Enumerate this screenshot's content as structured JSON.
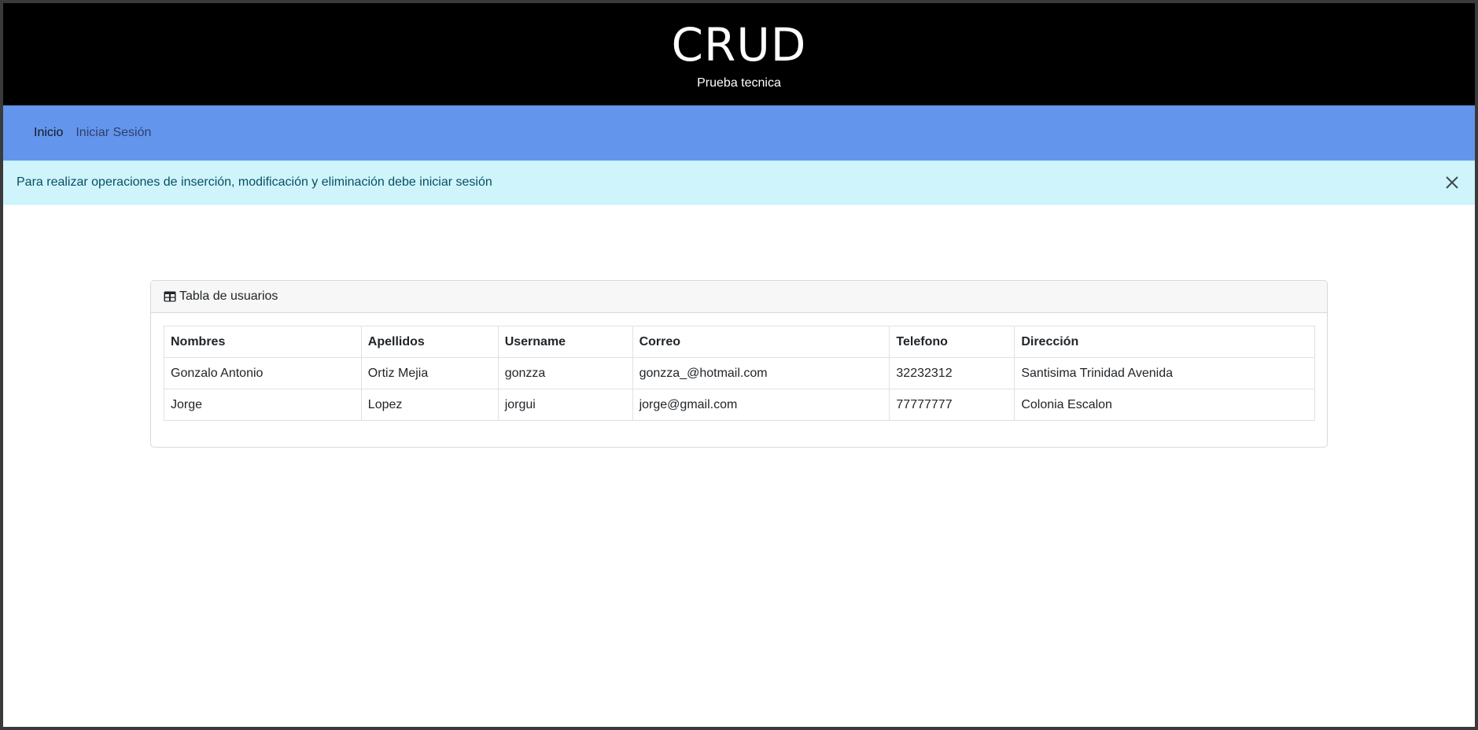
{
  "header": {
    "title": "CRUD",
    "subtitle": "Prueba tecnica"
  },
  "nav": {
    "items": [
      {
        "label": "Inicio",
        "active": true
      },
      {
        "label": "Iniciar Sesión",
        "active": false
      }
    ]
  },
  "alert": {
    "message": "Para realizar operaciones de inserción, modificación y eliminación debe iniciar sesión",
    "close_icon": "close-icon"
  },
  "card": {
    "title": "Tabla de usuarios",
    "icon": "table-icon"
  },
  "table": {
    "headers": [
      "Nombres",
      "Apellidos",
      "Username",
      "Correo",
      "Telefono",
      "Dirección"
    ],
    "rows": [
      [
        "Gonzalo Antonio",
        "Ortiz Mejia",
        "gonzza",
        "gonzza_@hotmail.com",
        "32232312",
        "Santisima Trinidad Avenida"
      ],
      [
        "Jorge",
        "Lopez",
        "jorgui",
        "jorge@gmail.com",
        "77777777",
        "Colonia Escalon"
      ]
    ]
  },
  "colors": {
    "header_bg": "#000000",
    "navbar_bg": "#6495ed",
    "alert_bg": "#cff4fc",
    "alert_text": "#055160"
  }
}
